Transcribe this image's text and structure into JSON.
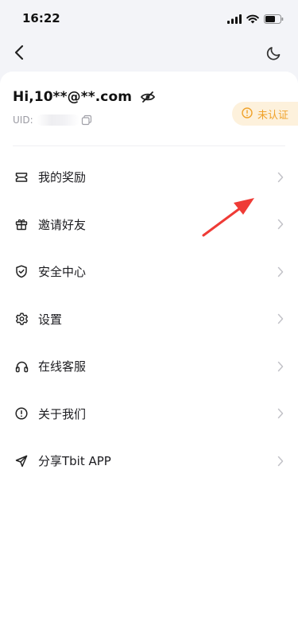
{
  "status_bar": {
    "time": "16:22"
  },
  "profile": {
    "greeting": "Hi,10**@**.com",
    "uid_label": "UID:",
    "verify_status": "未认证"
  },
  "menu": [
    {
      "label": "我的奖励",
      "icon": "ticket-icon"
    },
    {
      "label": "邀请好友",
      "icon": "gift-icon"
    },
    {
      "label": "安全中心",
      "icon": "shield-icon"
    },
    {
      "label": "设置",
      "icon": "gear-icon"
    },
    {
      "label": "在线客服",
      "icon": "headset-icon"
    },
    {
      "label": "关于我们",
      "icon": "info-icon"
    },
    {
      "label": "分享Tbit APP",
      "icon": "send-icon"
    }
  ],
  "colors": {
    "background": "#f3f4f8",
    "card": "#ffffff",
    "badge_bg": "#fdf1dc",
    "badge_text": "#f0a22a",
    "annotation_arrow": "#ef3b36"
  }
}
